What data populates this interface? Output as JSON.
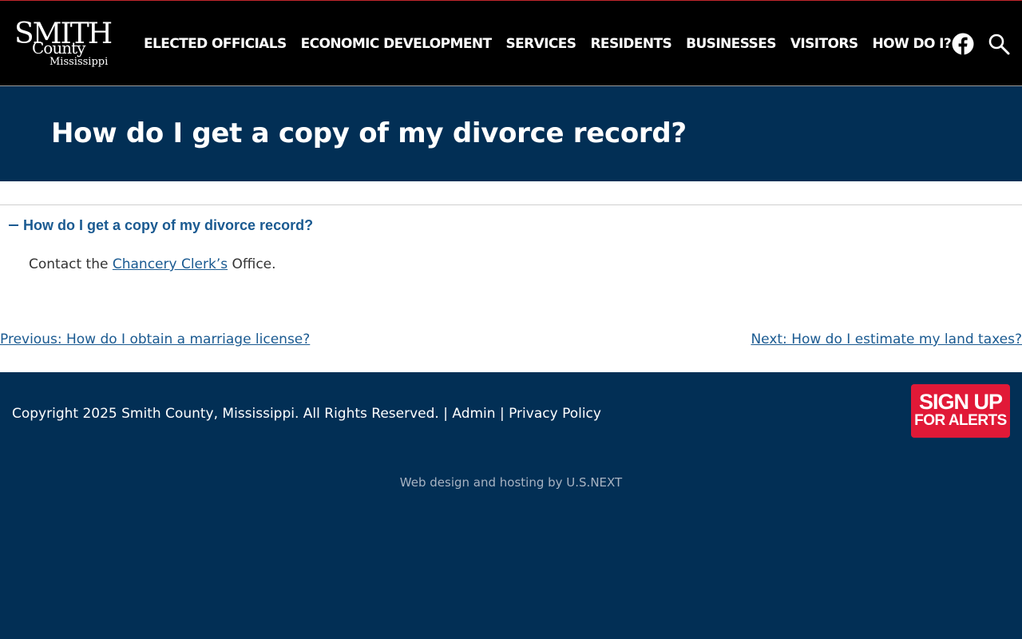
{
  "header": {
    "logo": {
      "line1": "SMITH",
      "line2": "County",
      "line3": "Mississippi"
    },
    "nav": [
      "ELECTED OFFICIALS",
      "ECONOMIC DEVELOPMENT",
      "SERVICES",
      "RESIDENTS",
      "BUSINESSES",
      "VISITORS",
      "HOW DO I?"
    ],
    "icons": {
      "social": "facebook-icon",
      "search": "search-icon"
    }
  },
  "page": {
    "title": "How do I get a copy of my divorce record?"
  },
  "faq": {
    "question": "How do I get a copy of my divorce record?",
    "answer_prefix": "Contact the ",
    "answer_link": "Chancery Clerk’s",
    "answer_suffix": " Office."
  },
  "pagination": {
    "previous": "Previous: How do I obtain a marriage license?",
    "next": "Next: How do I estimate my land taxes?"
  },
  "footer": {
    "copyright": "Copyright 2025 Smith County, Mississippi. All Rights Reserved.",
    "separator": " | ",
    "admin": "Admin",
    "privacy": "Privacy Policy",
    "signup_big": "SIGN UP",
    "signup_small": "FOR ALERTS",
    "credit": "Web design and hosting by U.S.NEXT"
  },
  "colors": {
    "header_bg": "#000000",
    "brand_navy": "#022f55",
    "link_blue": "#1a5a91",
    "alert_red": "#e11937"
  }
}
